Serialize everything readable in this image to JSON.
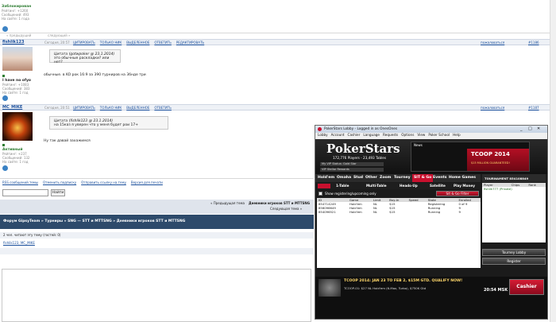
{
  "top": {
    "user_status": "Заблокирован",
    "rating": "Рейтинг: +1260",
    "messages": "Сообщений: 493",
    "joined": "На сайте: 1 года",
    "prev_topic": "« предыдущий",
    "next_topic": "следующий »"
  },
  "posts": [
    {
      "author": "fishlik123",
      "date": "Сегодня, 20:57",
      "tools": [
        "ЦИТИРОВАТЬ",
        "ТОЛЬКО НИК",
        "ВЫДЕЛЕННОЕ",
        "ОТВЕТИТЬ",
        "РЕДАКТИРОВАТЬ"
      ],
      "right_links": [
        "пожаловаться",
        "#1186"
      ],
      "quote": "Цитата (gotwpoker @ 23.1.2014)",
      "quote_body": "это обычные раскладки? или нет?",
      "body": "обычные. в KO рок 16:9 за 390 турниров на 3бнде три",
      "user_line1": "I have no ofyo",
      "rating": "Рейтинг: +1083",
      "messages": "Сообщений: 383",
      "joined": "На сайте: 1 год"
    },
    {
      "author": "MC_MIKE",
      "date": "Сегодня, 20:51",
      "tools": [
        "ЦИТИРОВАТЬ",
        "ТОЛЬКО НИК",
        "ВЫДЕЛЕННОЕ",
        "ОТВЕТИТЬ"
      ],
      "right_links": [
        "пожаловаться",
        "#1187"
      ],
      "quote": "Цитата (fishlik123 @ 23.1.2014)",
      "quote_body": "на 15каз я уверен что у меня будет рои 17+",
      "body": "Ну так давай захажимся",
      "user_line1": "Активный",
      "rating": "Рейтинг: +237",
      "messages": "Сообщений: 132",
      "joined": "На сайте: 1 год"
    }
  ],
  "bottom_links": [
    "RSS сообщений темы",
    "Отменить подписку",
    "Отправить ссылку на тему",
    "Версия для печати"
  ],
  "search_button": "Найти",
  "topic_nav": {
    "prev": "« Предыдущая тема",
    "current": "Дневники игроков STT и MTTSNG",
    "next": "Следующая тема »"
  },
  "breadcrumbs": [
    "Форум GipsyTeam",
    "Турниры",
    "SNG — STT и MTTSNG",
    "Дневники игроков STT и MTTSNG"
  ],
  "readers": "2 чел. читают эту тему (гостей: 0)",
  "reader_names": "fishlik123, MC_MIKE",
  "pokerstars": {
    "window_title": "PokerStars Lobby - Logged in as OnesOnes",
    "menu": [
      "Lobby",
      "Account",
      "Cashier",
      "Language",
      "Requests",
      "Options",
      "View",
      "Poker School",
      "Help"
    ],
    "logo": "PokerStars",
    "players_line": "172,776 Players - 23,493 Tables",
    "vip_status": "My VIP Status: Gold Star",
    "vip_rewards": "VIP Stellar Rewards",
    "news_label": "News",
    "banner_title": "TCOOP 2014",
    "banner_sub": "$15 MILLION GUARANTEED!",
    "game_tabs": [
      "Hold'em",
      "Omaha",
      "Stud",
      "Other",
      "Zoom",
      "Tourney",
      "SIT & Go",
      "Events",
      "Home Games"
    ],
    "sub_tabs": [
      "1-Table",
      "Multi-Table",
      "Heads-Up",
      "Satellite",
      "Play Money"
    ],
    "filter_label": "Show registering/upcoming only",
    "filter_button": "Sit & Go Filter",
    "columns": [
      "ID",
      "Game",
      "Limit",
      "Buy-In",
      "Speed",
      "State",
      "Enrolled"
    ],
    "rows": [
      [
        "854714249",
        "Hold'em",
        "NL",
        "$15",
        "",
        "Registering",
        "0 of 9"
      ],
      [
        "856096649",
        "Hold'em",
        "NL",
        "$15",
        "",
        "Running",
        "9"
      ],
      [
        "854096521",
        "Hold'em",
        "NL",
        "$15",
        "",
        "Running",
        "9"
      ]
    ],
    "side_title": "TOURNAMENT 854108849",
    "side_columns": [
      "Player",
      "Chips",
      "Rank"
    ],
    "side_row": "fishlik777 (Private)",
    "tourney_lobby": "Tourney Lobby",
    "register": "Register",
    "promo": "TCOOP 2014: JAN 23 TO FEB 2, $15M GTD. QUALIFY NOW!",
    "promo_sub": "TCOOP-01: $27 NL Hold'em (6-Max, Turbo), $750K Gtd",
    "time": "20:54 MSK",
    "cashier": "Cashier",
    "colors": {
      "red": "#c8102e",
      "dark": "#1b1b1b",
      "green": "#1e6b1e"
    }
  }
}
